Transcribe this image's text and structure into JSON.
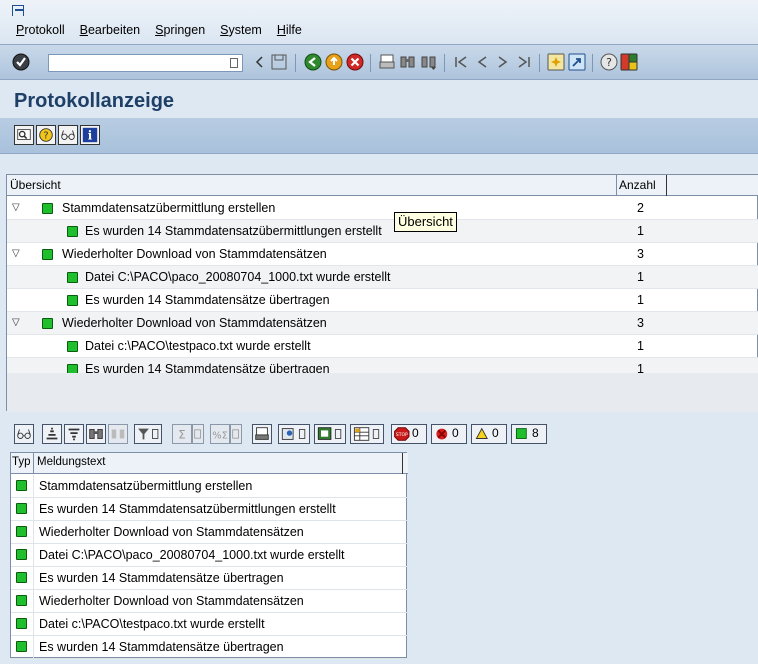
{
  "menu": {
    "items": [
      {
        "first": "P",
        "rest": "rotokoll"
      },
      {
        "first": "B",
        "rest": "earbeiten"
      },
      {
        "first": "S",
        "rest": "pringen"
      },
      {
        "first": "S",
        "rest": "ystem"
      },
      {
        "first": "H",
        "rest": "ilfe"
      }
    ]
  },
  "command_field": {
    "value": ""
  },
  "page": {
    "title": "Protokollanzeige"
  },
  "tree": {
    "header": {
      "main": "Übersicht",
      "count": "Anzahl"
    },
    "rows": [
      {
        "level": 0,
        "text": "Stammdatensatzübermittlung erstellen",
        "count": "2"
      },
      {
        "level": 1,
        "text": "Es wurden 14 Stammdatensatzübermittlungen erstellt",
        "count": "1"
      },
      {
        "level": 0,
        "text": "Wiederholter Download von Stammdatensätzen",
        "count": "3"
      },
      {
        "level": 1,
        "text": "Datei C:\\PACO\\paco_20080704_1000.txt wurde erstellt",
        "count": "1"
      },
      {
        "level": 1,
        "text": "Es wurden 14 Stammdatensätze übertragen",
        "count": "1"
      },
      {
        "level": 0,
        "text": "Wiederholter Download von Stammdatensätzen",
        "count": "3"
      },
      {
        "level": 1,
        "text": "Datei c:\\PACO\\testpaco.txt wurde erstellt",
        "count": "1"
      },
      {
        "level": 1,
        "text": "Es wurden 14 Stammdatensätze übertragen",
        "count": "1"
      }
    ],
    "tooltip": "Übersicht"
  },
  "message_counts": {
    "stop": "0",
    "error": "0",
    "warning": "0",
    "success": "8"
  },
  "messages": {
    "header": {
      "typ": "Typ",
      "text": "Meldungstext"
    },
    "rows": [
      "Stammdatensatzübermittlung erstellen",
      "Es wurden 14 Stammdatensatzübermittlungen erstellt",
      "Wiederholter Download von Stammdatensätzen",
      "Datei C:\\PACO\\paco_20080704_1000.txt wurde erstellt",
      "Es wurden 14 Stammdatensätze übertragen",
      "Wiederholter Download von Stammdatensätzen",
      "Datei c:\\PACO\\testpaco.txt wurde erstellt",
      "Es wurden 14 Stammdatensätze übertragen"
    ]
  },
  "colors": {
    "status_success": "#1fbe2c",
    "title": "#1e3f66",
    "background": "#dde8f3"
  }
}
